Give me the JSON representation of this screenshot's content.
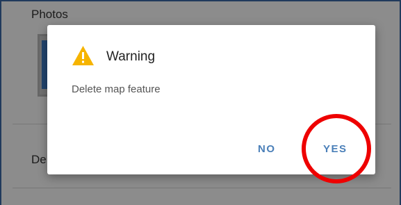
{
  "form": {
    "photos_label": "Photos",
    "description_label": "De"
  },
  "dialog": {
    "icon": "warning-triangle-icon",
    "title": "Warning",
    "message": "Delete map feature",
    "no_label": "NO",
    "yes_label": "YES"
  },
  "colors": {
    "accent": "#4a7fb8",
    "warning": "#f6b400",
    "highlight": "#ee0000",
    "frame": "#3d6aa8"
  }
}
